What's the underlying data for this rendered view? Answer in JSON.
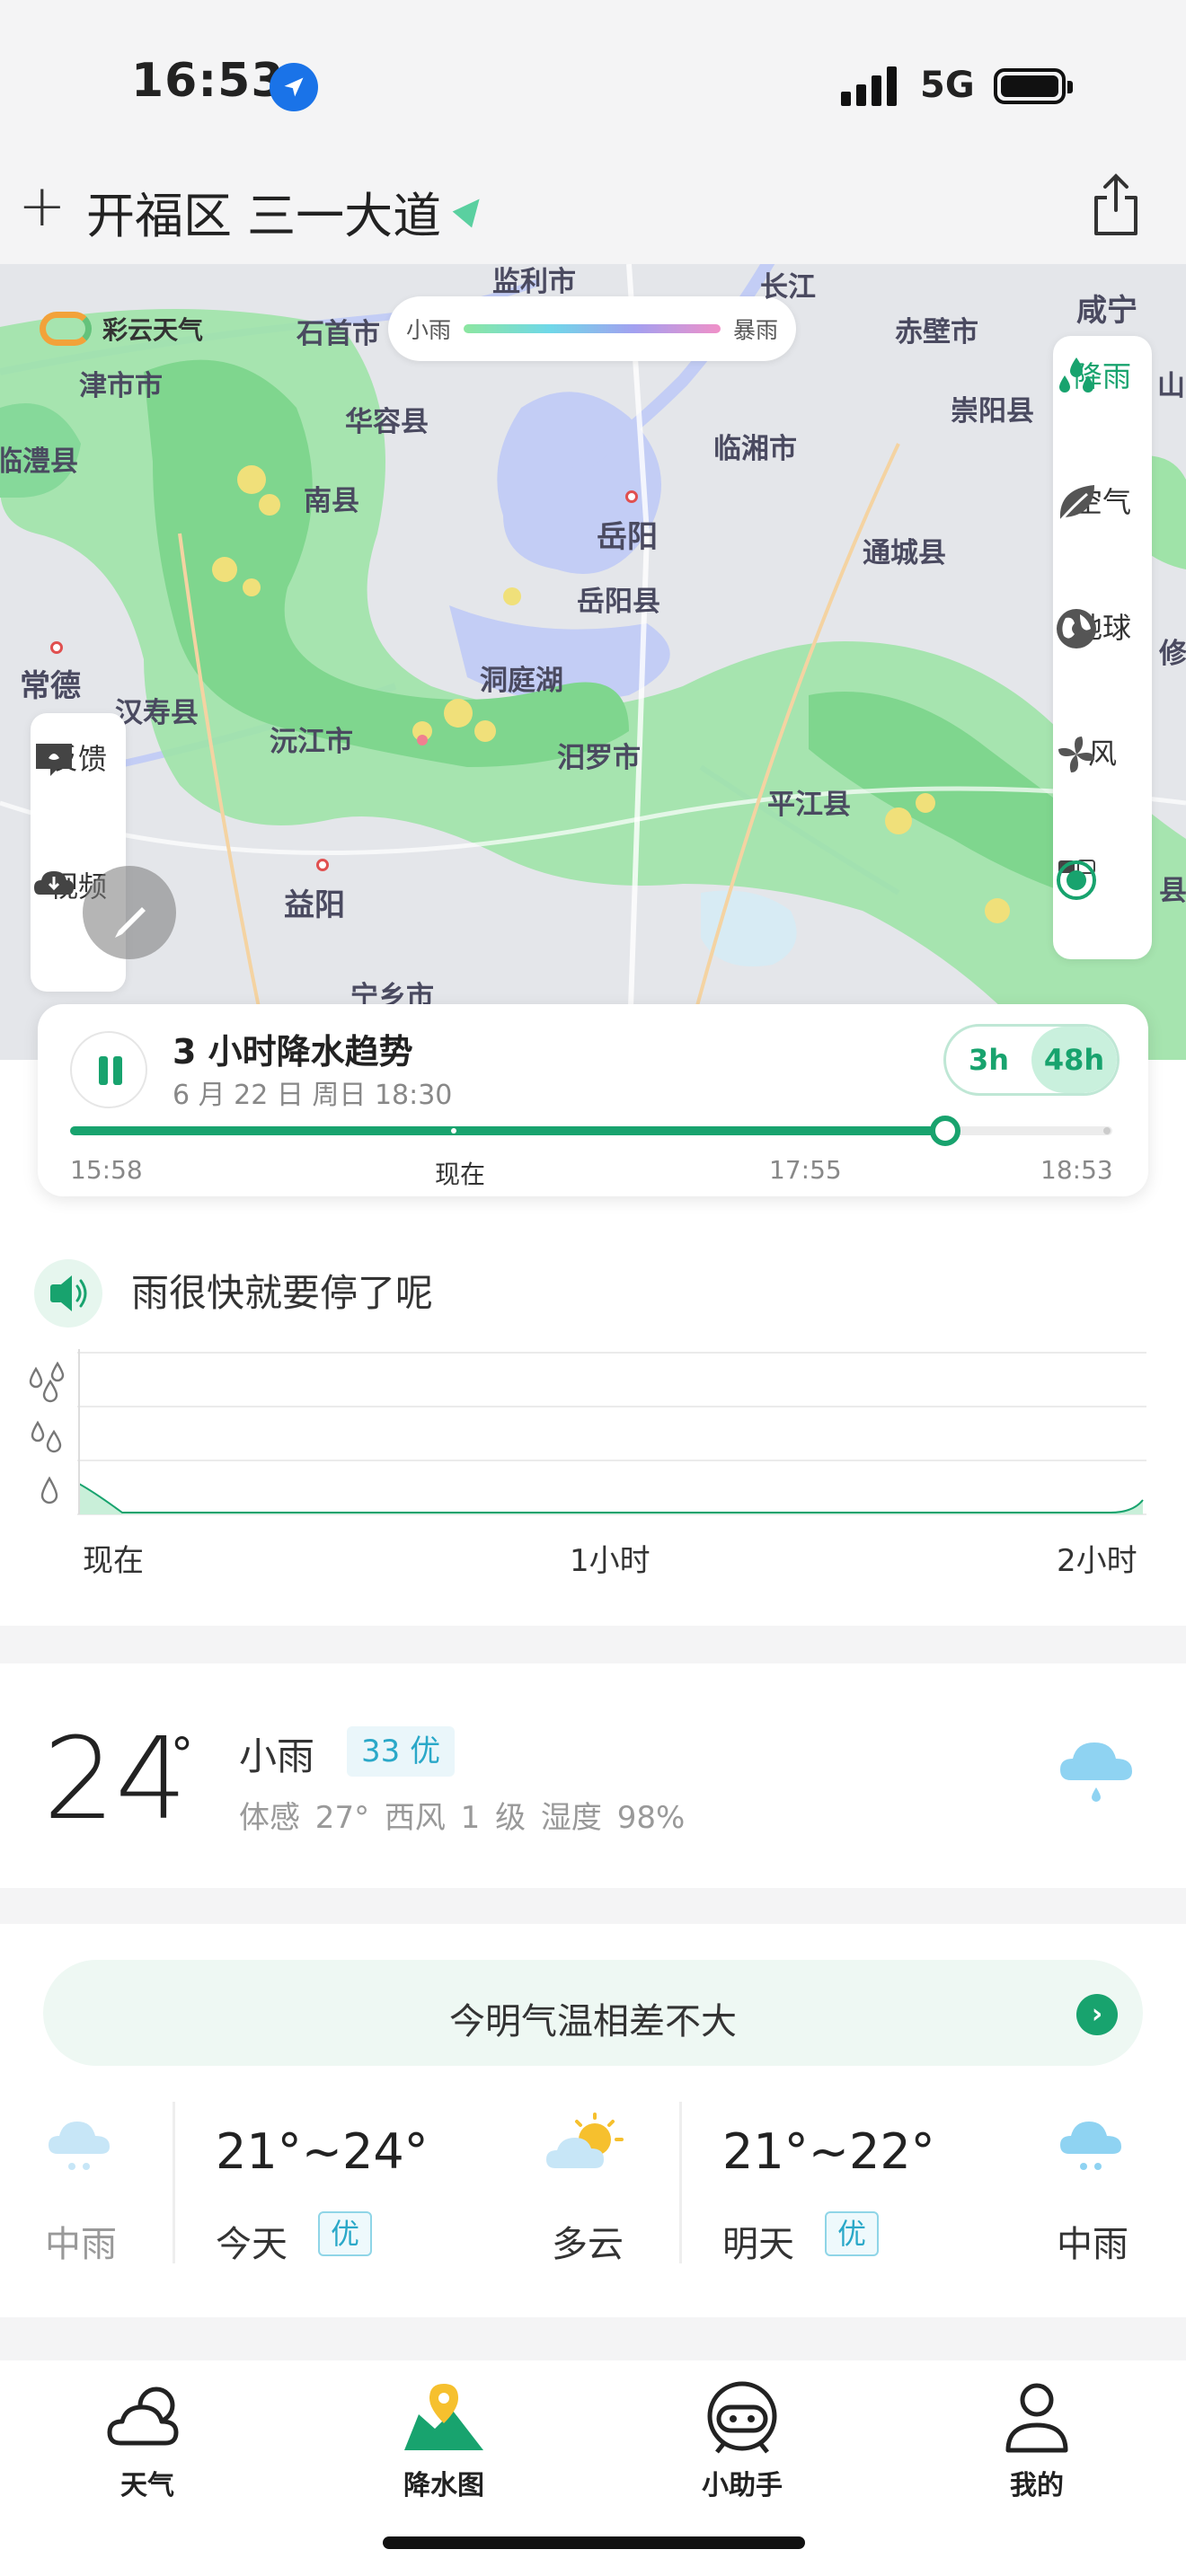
{
  "status_bar": {
    "time": "16:53",
    "network": "5G"
  },
  "header": {
    "add_label": "+",
    "location": "开福区 三一大道"
  },
  "map": {
    "brand": "彩云天气",
    "legend": {
      "min_label": "小雨",
      "max_label": "暴雨"
    },
    "labels": [
      "监利市",
      "长江",
      "咸宁",
      "石首市",
      "赤壁市",
      "津市市",
      "华容县",
      "崇阳县",
      "临澧县",
      "临湘市",
      "南县",
      "岳阳",
      "通城县",
      "岳阳县",
      "常德",
      "洞庭湖",
      "汉寿县",
      "沅江市",
      "汨罗市",
      "平江县",
      "益阳",
      "宁乡市",
      "山",
      "修",
      "县"
    ],
    "side_tools": [
      {
        "label": "降雨",
        "icon": "raindrops-icon",
        "active": true
      },
      {
        "label": "空气",
        "icon": "leaf-icon",
        "active": false
      },
      {
        "label": "地球",
        "icon": "globe-icon",
        "active": false
      },
      {
        "label": "风",
        "icon": "fan-icon",
        "active": false
      }
    ],
    "left_tools": [
      {
        "label": "反馈",
        "icon": "feedback-icon"
      },
      {
        "label": "视频",
        "icon": "video-icon"
      }
    ]
  },
  "trend": {
    "title": "3 小时降水趋势",
    "date": "6 月 22 日 周日 18:30",
    "range_options": [
      "3h",
      "48h"
    ],
    "selected_range": "48h",
    "progress": 0.84,
    "ticks": [
      "15:58",
      "现在",
      "17:55",
      "18:53"
    ]
  },
  "precip": {
    "message": "雨很快就要停了呢",
    "x_labels": [
      "现在",
      "1小时",
      "2小时"
    ],
    "levels": [
      "heavy",
      "moderate",
      "light"
    ]
  },
  "current": {
    "temperature": "24",
    "degree_symbol": "°",
    "condition": "小雨",
    "aqi": "33 优",
    "details": "体感 27° 西风 1 级 湿度 98%"
  },
  "forecast": {
    "banner": "今明气温相差不大",
    "today": {
      "day": "今天",
      "range": "21°~24°",
      "quality": "优",
      "left_cond": "中雨",
      "right_cond": "多云"
    },
    "tomorrow": {
      "day": "明天",
      "range": "21°~22°",
      "quality": "优",
      "right_cond": "中雨"
    }
  },
  "nav": [
    {
      "label": "天气",
      "icon": "weather-cloud-icon"
    },
    {
      "label": "降水图",
      "icon": "rain-map-icon"
    },
    {
      "label": "小助手",
      "icon": "assistant-icon"
    },
    {
      "label": "我的",
      "icon": "profile-icon"
    }
  ],
  "colors": {
    "accent": "#18a36e",
    "aqi": "#2aa8c8"
  }
}
